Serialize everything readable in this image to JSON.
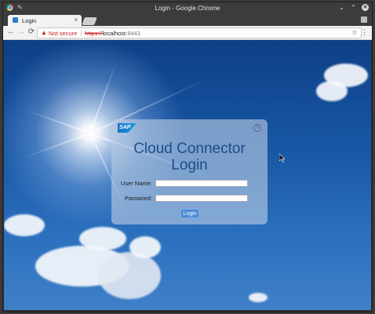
{
  "window": {
    "title": "Login - Google Chrome",
    "minimize_glyph": "⌄",
    "maximize_glyph": "⌃",
    "close_glyph": "✕"
  },
  "tab": {
    "label": "Login",
    "close_glyph": "×",
    "favicon": "sap-favicon-icon"
  },
  "toolbar": {
    "back_glyph": "←",
    "forward_glyph": "→",
    "reload_glyph": "⟳",
    "security_label": "Not secure",
    "url_scheme": "https://",
    "url_host": "localhost",
    "url_port": ":8443",
    "star_glyph": "☆",
    "menu_glyph": "⋮"
  },
  "login": {
    "logo_text": "SAP",
    "help_glyph": "?",
    "title_line1": "Cloud Connector",
    "title_line2": "Login",
    "username_label": "User Name:",
    "password_label": "Password:",
    "username_value": "",
    "password_value": "",
    "login_button": "Login"
  },
  "colors": {
    "titlebar": "#3c3c3c",
    "warning": "#c5221f",
    "heading": "#1f4d8a",
    "button": "#4a8ad2"
  }
}
